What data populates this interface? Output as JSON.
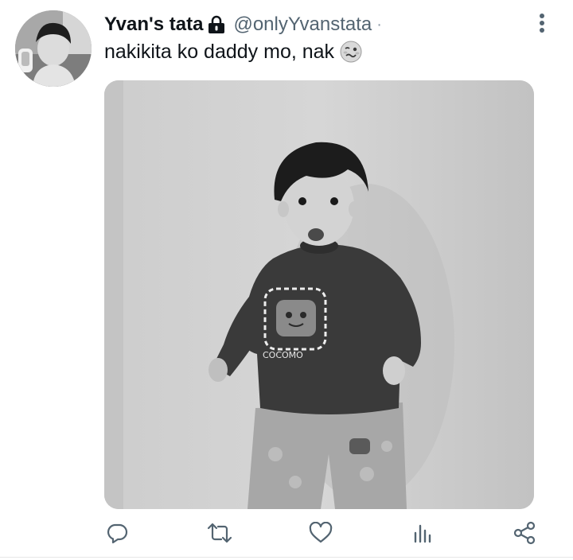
{
  "tweet": {
    "author": {
      "display_name": "Yvan's tata",
      "handle": "@onlyYvanstata",
      "protected_icon": "lock-icon",
      "avatar": "profile-photo-of-child"
    },
    "separator": "·",
    "text": "nakikita ko daddy mo, nak",
    "emoji": "woozy-face-emoji",
    "media": {
      "kind": "photo",
      "tone": "grayscale"
    },
    "menu_icon": "more-vertical-icon",
    "actions": [
      {
        "name": "reply",
        "icon": "reply-icon"
      },
      {
        "name": "retweet",
        "icon": "retweet-icon"
      },
      {
        "name": "like",
        "icon": "heart-icon"
      },
      {
        "name": "views",
        "icon": "analytics-icon"
      },
      {
        "name": "share",
        "icon": "share-icon"
      }
    ]
  },
  "colors": {
    "text_primary": "#0f1419",
    "text_secondary": "#536471",
    "icon_gray": "#536471",
    "background": "#ffffff"
  }
}
